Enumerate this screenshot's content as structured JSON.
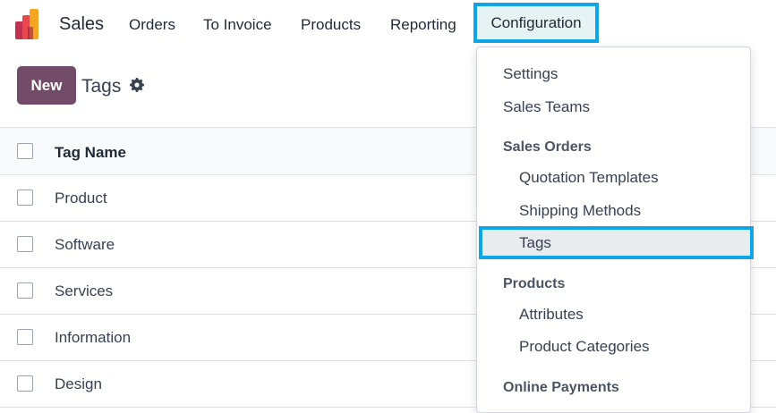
{
  "navbar": {
    "app_name": "Sales",
    "items": [
      "Orders",
      "To Invoice",
      "Products",
      "Reporting"
    ],
    "active": "Configuration"
  },
  "control_panel": {
    "new_label": "New",
    "title": "Tags",
    "gear_icon": "gear-icon"
  },
  "table": {
    "header": "Tag Name",
    "rows": [
      "Product",
      "Software",
      "Services",
      "Information",
      "Design"
    ]
  },
  "dropdown": {
    "items": [
      {
        "label": "Settings"
      },
      {
        "label": "Sales Teams"
      }
    ],
    "sections": [
      "Sales Orders",
      "Products",
      "Online Payments"
    ],
    "sales_orders_items": [
      "Quotation Templates",
      "Shipping Methods",
      "Tags"
    ],
    "products_items": [
      "Attributes",
      "Product Categories"
    ]
  },
  "colors": {
    "brand": "#714b67",
    "highlight": "#0ea5e9"
  }
}
